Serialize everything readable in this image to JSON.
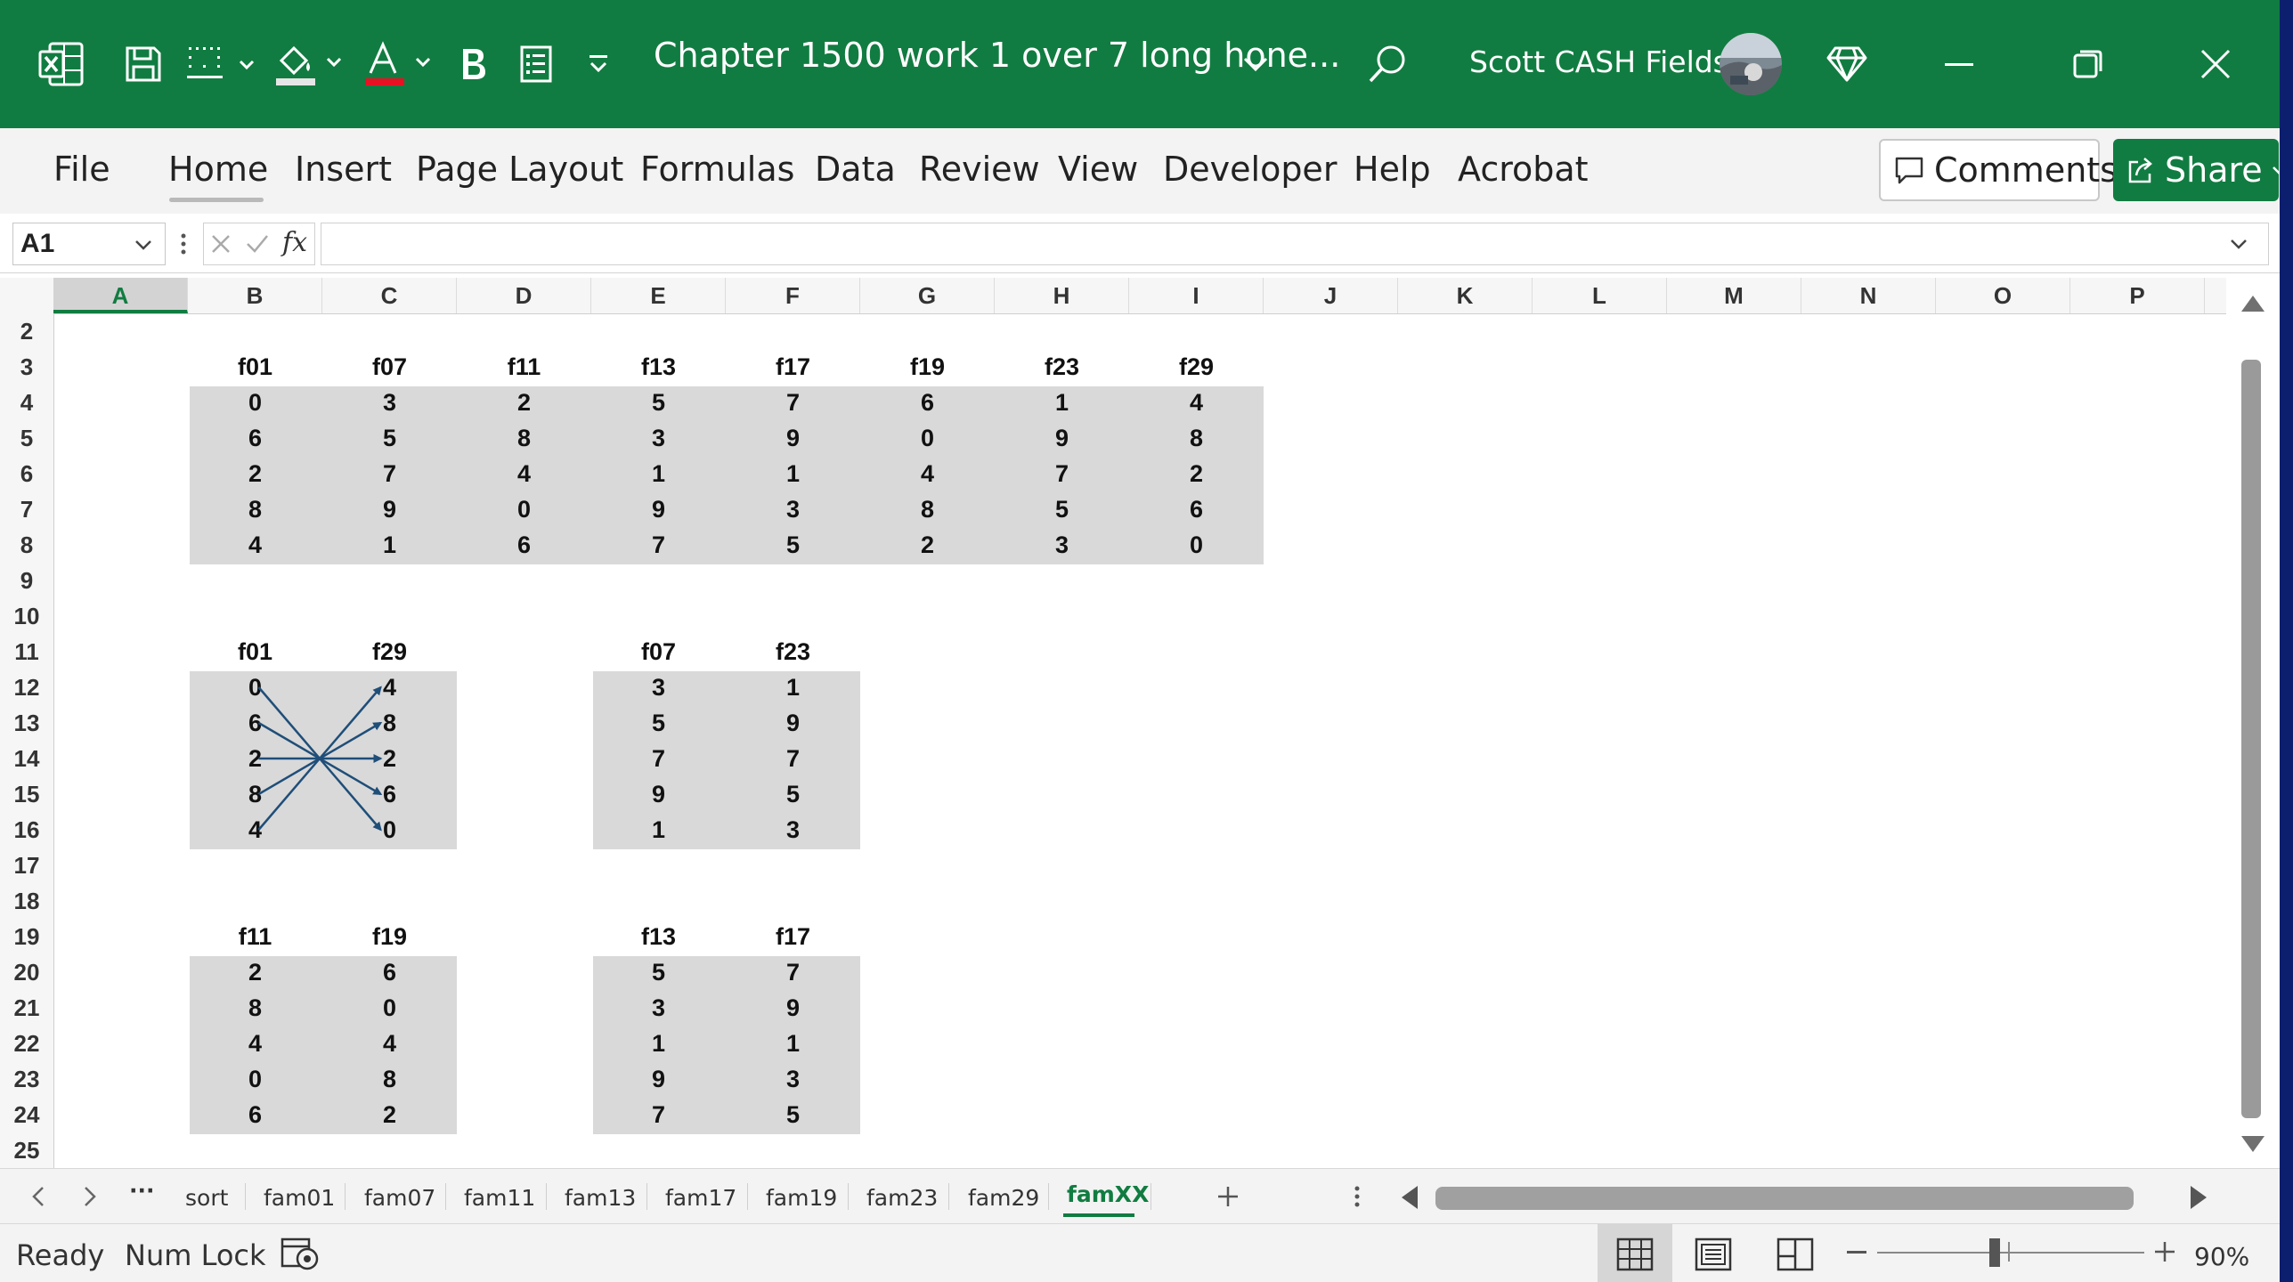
{
  "window": {
    "doc_title": "Chapter 1500 work 1 over 7 long hone...",
    "user_name": "Scott CASH Fields",
    "accent": "#117c41"
  },
  "ribbon": {
    "tabs": [
      "File",
      "Home",
      "Insert",
      "Page Layout",
      "Formulas",
      "Data",
      "Review",
      "View",
      "Developer",
      "Help",
      "Acrobat"
    ],
    "active_tab": "Home",
    "comments_label": "Comments",
    "share_label": "Share"
  },
  "formula_bar": {
    "name_box": "A1",
    "fx_label": "fx",
    "value": ""
  },
  "grid": {
    "columns": [
      "A",
      "B",
      "C",
      "D",
      "E",
      "F",
      "G",
      "H",
      "I",
      "J",
      "K",
      "L",
      "M",
      "N",
      "O",
      "P"
    ],
    "selected_column": "A",
    "rows": [
      "2",
      "3",
      "4",
      "5",
      "6",
      "7",
      "8",
      "9",
      "10",
      "11",
      "12",
      "13",
      "14",
      "15",
      "16",
      "17",
      "18",
      "19",
      "20",
      "21",
      "22",
      "23",
      "24",
      "25"
    ],
    "main_table": {
      "headers": [
        "f01",
        "f07",
        "f11",
        "f13",
        "f17",
        "f19",
        "f23",
        "f29"
      ],
      "rows": [
        [
          "0",
          "3",
          "2",
          "5",
          "7",
          "6",
          "1",
          "4"
        ],
        [
          "6",
          "5",
          "8",
          "3",
          "9",
          "0",
          "9",
          "8"
        ],
        [
          "2",
          "7",
          "4",
          "1",
          "1",
          "4",
          "7",
          "2"
        ],
        [
          "8",
          "9",
          "0",
          "9",
          "3",
          "8",
          "5",
          "6"
        ],
        [
          "4",
          "1",
          "6",
          "7",
          "5",
          "2",
          "3",
          "0"
        ]
      ]
    },
    "pair_tables": [
      {
        "headers": [
          "f01",
          "f29"
        ],
        "rows": [
          [
            "0",
            "4"
          ],
          [
            "6",
            "8"
          ],
          [
            "2",
            "2"
          ],
          [
            "8",
            "6"
          ],
          [
            "4",
            "0"
          ]
        ]
      },
      {
        "headers": [
          "f07",
          "f23"
        ],
        "rows": [
          [
            "3",
            "1"
          ],
          [
            "5",
            "9"
          ],
          [
            "7",
            "7"
          ],
          [
            "9",
            "5"
          ],
          [
            "1",
            "3"
          ]
        ]
      },
      {
        "headers": [
          "f11",
          "f19"
        ],
        "rows": [
          [
            "2",
            "6"
          ],
          [
            "8",
            "0"
          ],
          [
            "4",
            "4"
          ],
          [
            "0",
            "8"
          ],
          [
            "6",
            "2"
          ]
        ]
      },
      {
        "headers": [
          "f13",
          "f17"
        ],
        "rows": [
          [
            "5",
            "7"
          ],
          [
            "3",
            "9"
          ],
          [
            "1",
            "1"
          ],
          [
            "9",
            "3"
          ],
          [
            "7",
            "5"
          ]
        ]
      }
    ]
  },
  "sheet_tabs": {
    "tabs": [
      "sort",
      "fam01",
      "fam07",
      "fam11",
      "fam13",
      "fam17",
      "fam19",
      "fam23",
      "fam29",
      "famXX"
    ],
    "active": "famXX",
    "more": "···"
  },
  "status_bar": {
    "ready": "Ready",
    "num_lock": "Num Lock",
    "zoom": "90%"
  }
}
